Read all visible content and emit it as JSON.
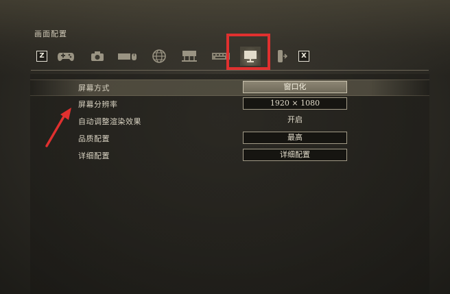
{
  "page": {
    "title": "画面配置"
  },
  "tabs": [
    {
      "key": "Z",
      "icon": "z-key-icon"
    },
    {
      "icon": "gamepad-icon"
    },
    {
      "icon": "camera-icon"
    },
    {
      "icon": "keyboard-mouse-icon"
    },
    {
      "icon": "globe-icon"
    },
    {
      "icon": "network-icon"
    },
    {
      "icon": "keyboard-icon"
    },
    {
      "icon": "monitor-icon",
      "active": true
    },
    {
      "icon": "speaker-icon"
    },
    {
      "key": "X",
      "icon": "x-key-icon"
    }
  ],
  "keys": {
    "left": "Z",
    "right": "X"
  },
  "settings": [
    {
      "label": "屏幕方式",
      "value": "窗口化"
    },
    {
      "label": "屏幕分辨率",
      "value": "1920 × 1080"
    },
    {
      "label": "自动调整渲染效果",
      "value": "开启"
    },
    {
      "label": "品质配置",
      "value": "最高"
    },
    {
      "label": "详细配置",
      "value": "详细配置"
    }
  ],
  "colors": {
    "highlight": "#e0302f",
    "arrow": "#e0302f"
  }
}
